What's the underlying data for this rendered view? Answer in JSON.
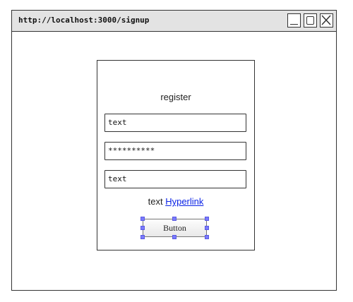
{
  "window": {
    "url": "http://localhost:3000/signup",
    "controls": [
      "minimize-icon",
      "maximize-icon",
      "close-icon"
    ]
  },
  "form": {
    "heading": "register",
    "fields": [
      {
        "value": "text"
      },
      {
        "value": "**********"
      },
      {
        "value": "text"
      }
    ],
    "link_row": {
      "text": "text",
      "link_label": "Hyperlink"
    },
    "button_label": "Button"
  },
  "colors": {
    "link": "#0b23e6",
    "selection_handle": "#7b7bff"
  }
}
